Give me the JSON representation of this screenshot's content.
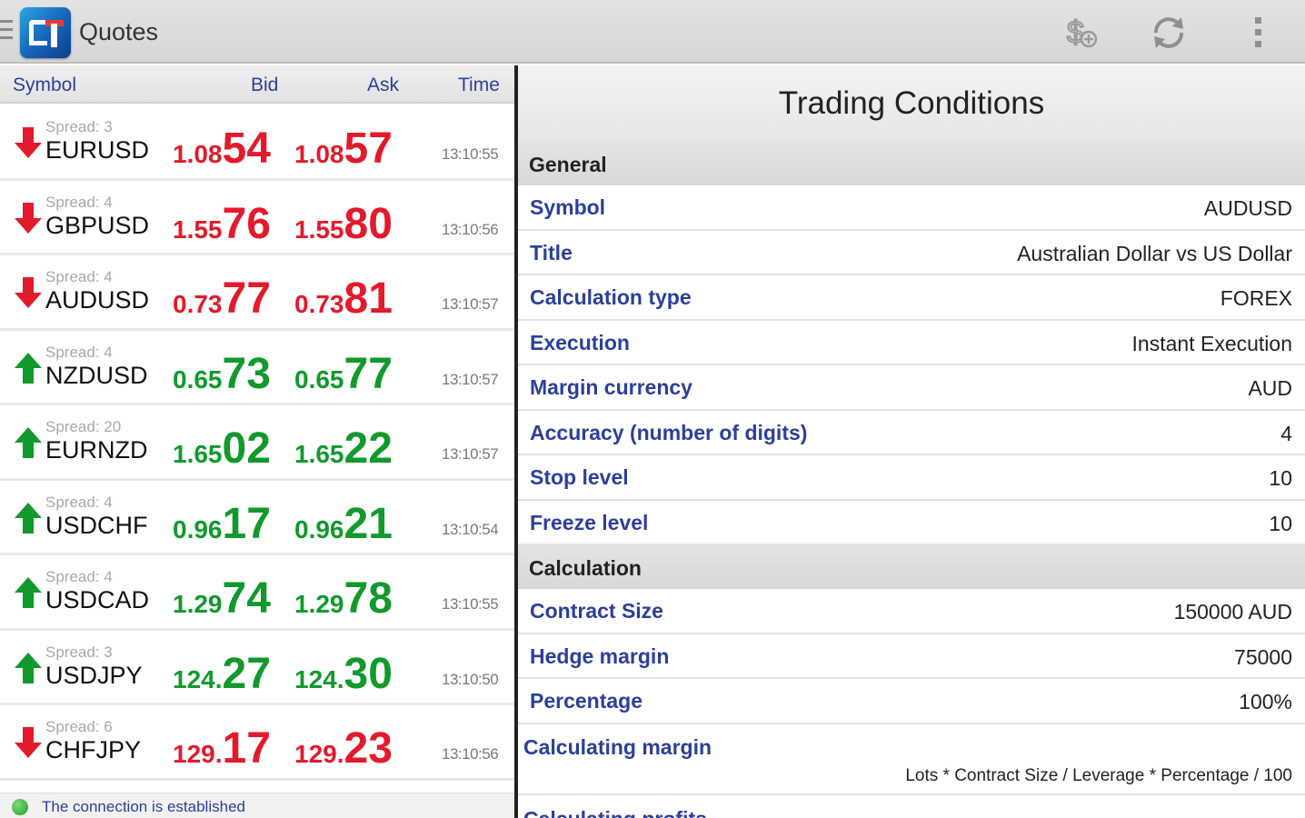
{
  "app": {
    "title": "Quotes",
    "logo": "mt4-logo"
  },
  "toolbar": {
    "icons": [
      "dollar-icon",
      "refresh-icon",
      "overflow-menu-icon"
    ]
  },
  "quotes": {
    "headers": {
      "symbol": "Symbol",
      "bid": "Bid",
      "ask": "Ask",
      "time": "Time"
    },
    "colors": {
      "up": "#12992c",
      "down": "#e21a2b"
    },
    "rows": [
      {
        "direction": "down",
        "spread": "Spread: 3",
        "symbol": "EURUSD",
        "bid_small": "1.08",
        "bid_big": "54",
        "ask_small": "1.08",
        "ask_big": "57",
        "time": "13:10:55"
      },
      {
        "direction": "down",
        "spread": "Spread: 4",
        "symbol": "GBPUSD",
        "bid_small": "1.55",
        "bid_big": "76",
        "ask_small": "1.55",
        "ask_big": "80",
        "time": "13:10:56"
      },
      {
        "direction": "down",
        "spread": "Spread: 4",
        "symbol": "AUDUSD",
        "bid_small": "0.73",
        "bid_big": "77",
        "ask_small": "0.73",
        "ask_big": "81",
        "time": "13:10:57"
      },
      {
        "direction": "up",
        "spread": "Spread: 4",
        "symbol": "NZDUSD",
        "bid_small": "0.65",
        "bid_big": "73",
        "ask_small": "0.65",
        "ask_big": "77",
        "time": "13:10:57"
      },
      {
        "direction": "up",
        "spread": "Spread: 20",
        "symbol": "EURNZD",
        "bid_small": "1.65",
        "bid_big": "02",
        "ask_small": "1.65",
        "ask_big": "22",
        "time": "13:10:57"
      },
      {
        "direction": "up",
        "spread": "Spread: 4",
        "symbol": "USDCHF",
        "bid_small": "0.96",
        "bid_big": "17",
        "ask_small": "0.96",
        "ask_big": "21",
        "time": "13:10:54"
      },
      {
        "direction": "up",
        "spread": "Spread: 4",
        "symbol": "USDCAD",
        "bid_small": "1.29",
        "bid_big": "74",
        "ask_small": "1.29",
        "ask_big": "78",
        "time": "13:10:55"
      },
      {
        "direction": "up",
        "spread": "Spread: 3",
        "symbol": "USDJPY",
        "bid_small": "124.",
        "bid_big": "27",
        "ask_small": "124.",
        "ask_big": "30",
        "time": "13:10:50"
      },
      {
        "direction": "down",
        "spread": "Spread: 6",
        "symbol": "CHFJPY",
        "bid_small": "129.",
        "bid_big": "17",
        "ask_small": "129.",
        "ask_big": "23",
        "time": "13:10:56"
      }
    ]
  },
  "status": {
    "text": "The connection is established"
  },
  "conditions": {
    "title": "Trading Conditions",
    "general_header": "General",
    "general": [
      {
        "label": "Symbol",
        "value": "AUDUSD"
      },
      {
        "label": "Title",
        "value": "Australian Dollar vs US Dollar"
      },
      {
        "label": "Calculation type",
        "value": "FOREX"
      },
      {
        "label": "Execution",
        "value": "Instant Execution"
      },
      {
        "label": "Margin currency",
        "value": "AUD"
      },
      {
        "label": "Accuracy (number of digits)",
        "value": "4"
      },
      {
        "label": "Stop level",
        "value": "10"
      },
      {
        "label": "Freeze level",
        "value": "10"
      }
    ],
    "calculation_header": "Calculation",
    "calculation": [
      {
        "label": "Contract Size",
        "value": "150000 AUD"
      },
      {
        "label": "Hedge margin",
        "value": "75000"
      },
      {
        "label": "Percentage",
        "value": "100%"
      }
    ],
    "calculating_margin": {
      "label": "Calculating margin",
      "value": "Lots * Contract Size / Leverage * Percentage / 100"
    },
    "next_label": "Calculating profits"
  }
}
